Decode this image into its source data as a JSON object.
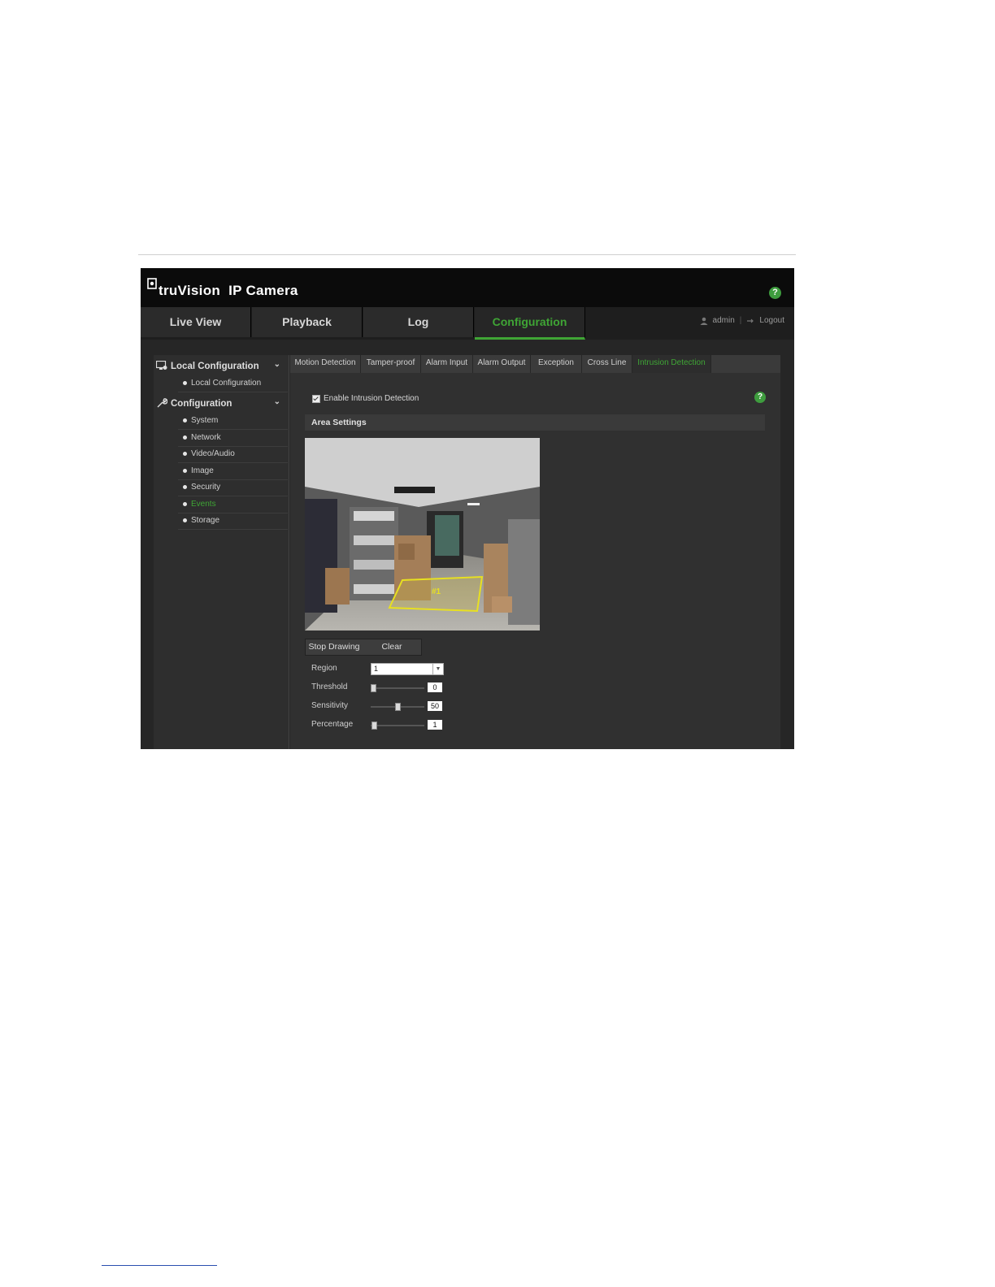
{
  "header": {
    "brand_name": "truVision",
    "brand_sub": "IP Camera",
    "help": "?"
  },
  "nav": {
    "tabs": [
      {
        "label": "Live View"
      },
      {
        "label": "Playback"
      },
      {
        "label": "Log"
      },
      {
        "label": "Configuration",
        "active": true
      }
    ],
    "user": "admin",
    "logout": "Logout",
    "separator": "|"
  },
  "sidebar": {
    "local_config": {
      "title": "Local Configuration",
      "items": [
        {
          "label": "Local Configuration"
        }
      ]
    },
    "configuration": {
      "title": "Configuration",
      "items": [
        {
          "label": "System"
        },
        {
          "label": "Network"
        },
        {
          "label": "Video/Audio"
        },
        {
          "label": "Image"
        },
        {
          "label": "Security"
        },
        {
          "label": "Events",
          "active": true
        },
        {
          "label": "Storage"
        }
      ]
    }
  },
  "subtabs": [
    {
      "label": "Motion Detection"
    },
    {
      "label": "Tamper-proof"
    },
    {
      "label": "Alarm Input"
    },
    {
      "label": "Alarm Output"
    },
    {
      "label": "Exception"
    },
    {
      "label": "Cross Line"
    },
    {
      "label": "Intrusion Detection",
      "active": true
    }
  ],
  "content": {
    "enable_label": "Enable Intrusion Detection",
    "enable_checked": true,
    "help": "?",
    "area_title": "Area Settings",
    "video_region_label": "#1",
    "stop_drawing": "Stop Drawing",
    "clear": "Clear",
    "region_label": "Region",
    "region_value": "1",
    "threshold_label": "Threshold",
    "threshold_value": "0",
    "sensitivity_label": "Sensitivity",
    "sensitivity_value": "50",
    "percentage_label": "Percentage",
    "percentage_value": "1"
  },
  "colors": {
    "accent": "#3fa535",
    "header_bg": "#0b0b0b",
    "panel_bg": "#303030",
    "region_outline": "#e8e020"
  }
}
